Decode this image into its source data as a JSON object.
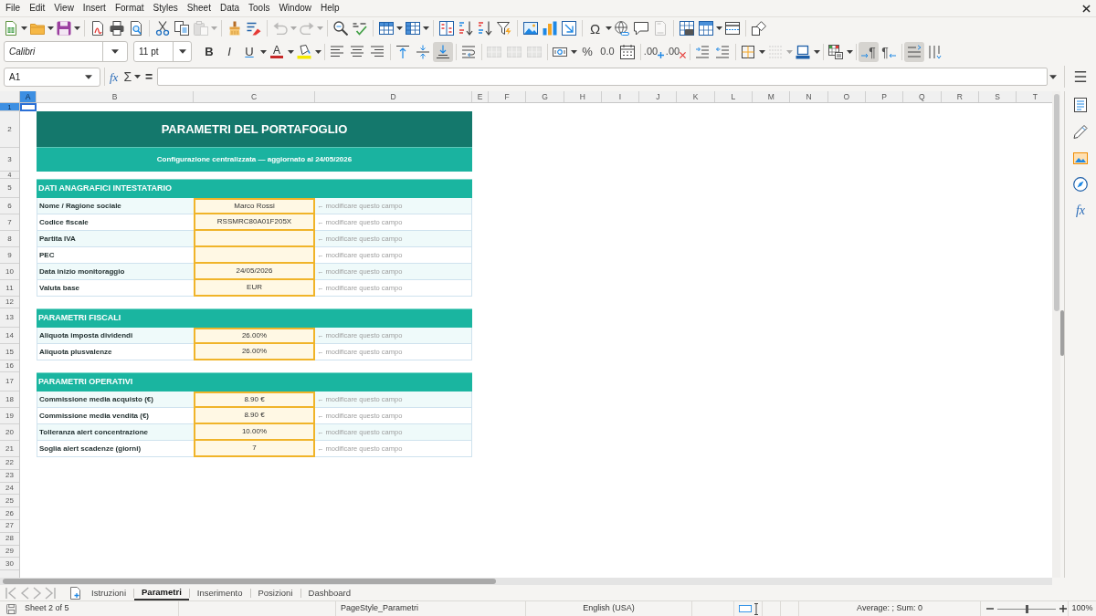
{
  "menu_bar": [
    "File",
    "Edit",
    "View",
    "Insert",
    "Format",
    "Styles",
    "Sheet",
    "Data",
    "Tools",
    "Window",
    "Help"
  ],
  "standard_toolbar": {
    "paste": {
      "disabled": true
    },
    "undo": {
      "disabled": true
    },
    "redo": {
      "disabled": true
    },
    "header_footer": {
      "disabled": true
    },
    "special_character": "Ω"
  },
  "formatting_toolbar": {
    "font_name": "Calibri",
    "font_size": "11 pt",
    "bold": "B",
    "italic": "I",
    "underline": "U",
    "font_color": "A",
    "vertical_align": [
      {
        "selected": false
      },
      {
        "selected": false
      },
      {
        "selected": true
      }
    ],
    "merge": {
      "disabled": true
    },
    "percent": "%",
    "number": "0.0",
    "add_decimal": ".00",
    "delete_decimal": ".00",
    "border_style": {
      "disabled": true
    },
    "paragraph_direction": [
      {
        "label": "¶",
        "selected": true
      },
      {
        "label": "¶",
        "selected": false
      }
    ],
    "text_orientation": [
      {
        "selected": true
      },
      {
        "selected": false
      }
    ]
  },
  "formula_bar": {
    "name_box": "A1",
    "function_wizard": "fx",
    "sum": "Σ",
    "formula": "="
  },
  "sidebar": {
    "functions": "fx"
  },
  "columns": [
    {
      "label": "A",
      "selected": true
    },
    {
      "label": "B",
      "selected": false
    },
    {
      "label": "C",
      "selected": false
    },
    {
      "label": "D",
      "selected": false
    },
    {
      "label": "E",
      "selected": false
    },
    {
      "label": "F",
      "selected": false
    },
    {
      "label": "G",
      "selected": false
    },
    {
      "label": "H",
      "selected": false
    },
    {
      "label": "I",
      "selected": false
    },
    {
      "label": "J",
      "selected": false
    },
    {
      "label": "K",
      "selected": false
    },
    {
      "label": "L",
      "selected": false
    },
    {
      "label": "M",
      "selected": false
    },
    {
      "label": "N",
      "selected": false
    },
    {
      "label": "O",
      "selected": false
    },
    {
      "label": "P",
      "selected": false
    },
    {
      "label": "Q",
      "selected": false
    },
    {
      "label": "R",
      "selected": false
    },
    {
      "label": "S",
      "selected": false
    },
    {
      "label": "T",
      "selected": false
    }
  ],
  "rows": [
    {
      "label": "1",
      "selected": true
    },
    {
      "label": "2",
      "selected": false
    },
    {
      "label": "3",
      "selected": false
    },
    {
      "label": "4",
      "selected": false
    },
    {
      "label": "5",
      "selected": false
    },
    {
      "label": "6",
      "selected": false
    },
    {
      "label": "7",
      "selected": false
    },
    {
      "label": "8",
      "selected": false
    },
    {
      "label": "9",
      "selected": false
    },
    {
      "label": "10",
      "selected": false
    },
    {
      "label": "11",
      "selected": false
    },
    {
      "label": "12",
      "selected": false
    },
    {
      "label": "13",
      "selected": false
    },
    {
      "label": "14",
      "selected": false
    },
    {
      "label": "15",
      "selected": false
    },
    {
      "label": "16",
      "selected": false
    },
    {
      "label": "17",
      "selected": false
    },
    {
      "label": "18",
      "selected": false
    },
    {
      "label": "19",
      "selected": false
    },
    {
      "label": "20",
      "selected": false
    },
    {
      "label": "21",
      "selected": false
    },
    {
      "label": "22",
      "selected": false
    },
    {
      "label": "23",
      "selected": false
    },
    {
      "label": "24",
      "selected": false
    },
    {
      "label": "25",
      "selected": false
    },
    {
      "label": "26",
      "selected": false
    },
    {
      "label": "27",
      "selected": false
    },
    {
      "label": "28",
      "selected": false
    },
    {
      "label": "29",
      "selected": false
    },
    {
      "label": "30",
      "selected": false
    }
  ],
  "sheet": {
    "title": "PARAMETRI DEL PORTAFOGLIO",
    "subtitle": "Configurazione centralizzata — aggiornato al 24/05/2026",
    "sections": [
      {
        "heading": "DATI ANAGRAFICI INTESTATARIO",
        "fields": [
          {
            "label": "Nome / Ragione sociale",
            "value": "Marco Rossi",
            "hint": "← modificare questo campo"
          },
          {
            "label": "Codice fiscale",
            "value": "RSSMRC80A01F205X",
            "hint": "← modificare questo campo"
          },
          {
            "label": "Partita IVA",
            "hint": "← modificare questo campo"
          },
          {
            "label": "PEC",
            "hint": "← modificare questo campo"
          },
          {
            "label": "Data inizio monitoraggio",
            "value": "24/05/2026",
            "hint": "← modificare questo campo"
          },
          {
            "label": "Valuta base",
            "value": "EUR",
            "hint": "← modificare questo campo"
          }
        ]
      },
      {
        "heading": "PARAMETRI FISCALI",
        "fields": [
          {
            "label": "Aliquota imposta dividendi",
            "value": "26.00%",
            "hint": "← modificare questo campo"
          },
          {
            "label": "Aliquota plusvalenze",
            "value": "26.00%",
            "hint": "← modificare questo campo"
          }
        ]
      },
      {
        "heading": "PARAMETRI OPERATIVI",
        "fields": [
          {
            "label": "Commissione media acquisto (€)",
            "value": "8.90 €",
            "hint": "← modificare questo campo"
          },
          {
            "label": "Commissione media vendita (€)",
            "value": "8.90 €",
            "hint": "← modificare questo campo"
          },
          {
            "label": "Tolleranza alert concentrazione",
            "value": "10.00%",
            "hint": "← modificare questo campo"
          },
          {
            "label": "Soglia alert scadenze (giorni)",
            "value": "7",
            "hint": "← modificare questo campo"
          }
        ]
      }
    ]
  },
  "sheet_tabs": [
    {
      "label": "Istruzioni",
      "selected": false
    },
    {
      "label": "Parametri",
      "selected": true
    },
    {
      "label": "Inserimento",
      "selected": false
    },
    {
      "label": "Posizioni",
      "selected": false
    },
    {
      "label": "Dashboard",
      "selected": false
    }
  ],
  "status_bar": {
    "sheet": "Sheet 2 of 5",
    "page_style": "PageStyle_Parametri",
    "language": "English (USA)",
    "summary": "Average: ; Sum: 0",
    "zoom_slider": {
      "level": 0.5
    },
    "zoom": "100%"
  }
}
